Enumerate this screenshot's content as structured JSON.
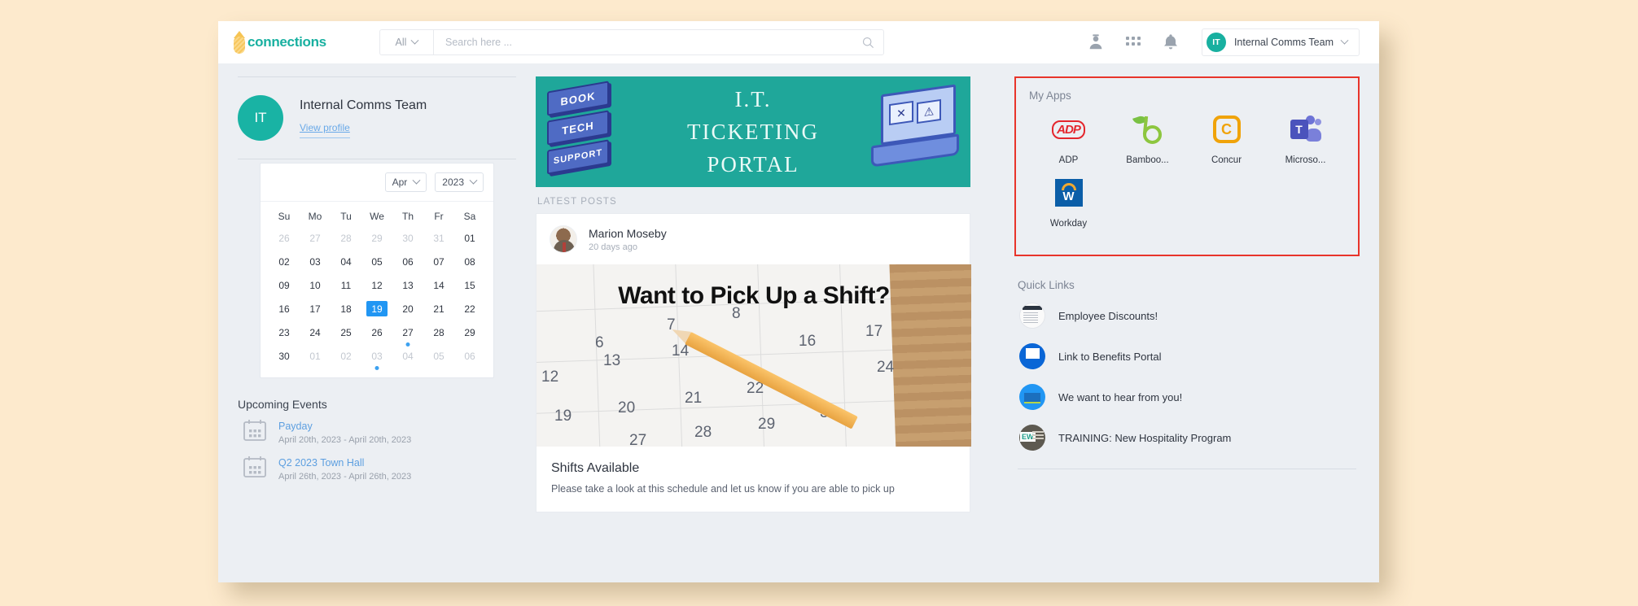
{
  "topbar": {
    "logo_text": "connections",
    "logo_icon": "pineapple-icon",
    "search_scope": "All",
    "search_value": "",
    "search_placeholder": "Search here ...",
    "search_icon": "search-icon",
    "admin_icon": "admin-person-icon",
    "apps_icon": "apps-grid-icon",
    "notifications_icon": "bell-icon",
    "user_initials": "IT",
    "user_name": "Internal Comms Team",
    "user_chevron_icon": "chevron-down-icon"
  },
  "profile": {
    "initials": "IT",
    "name": "Internal Comms Team",
    "view_profile": "View profile"
  },
  "calendar": {
    "month": "Apr",
    "year": "2023",
    "month_chevron_icon": "chevron-down-icon",
    "year_chevron_icon": "chevron-down-icon",
    "dow": [
      "Su",
      "Mo",
      "Tu",
      "We",
      "Th",
      "Fr",
      "Sa"
    ],
    "weeks": [
      [
        {
          "d": "26",
          "mute": true
        },
        {
          "d": "27",
          "mute": true
        },
        {
          "d": "28",
          "mute": true
        },
        {
          "d": "29",
          "mute": true
        },
        {
          "d": "30",
          "mute": true
        },
        {
          "d": "31",
          "mute": true
        },
        {
          "d": "01",
          "mute": false
        }
      ],
      [
        {
          "d": "02"
        },
        {
          "d": "03"
        },
        {
          "d": "04"
        },
        {
          "d": "05"
        },
        {
          "d": "06"
        },
        {
          "d": "07"
        },
        {
          "d": "08"
        }
      ],
      [
        {
          "d": "09"
        },
        {
          "d": "10"
        },
        {
          "d": "11"
        },
        {
          "d": "12"
        },
        {
          "d": "13"
        },
        {
          "d": "14"
        },
        {
          "d": "15"
        }
      ],
      [
        {
          "d": "16"
        },
        {
          "d": "17"
        },
        {
          "d": "18"
        },
        {
          "d": "19",
          "selected": true
        },
        {
          "d": "20"
        },
        {
          "d": "21"
        },
        {
          "d": "22"
        }
      ],
      [
        {
          "d": "23"
        },
        {
          "d": "24"
        },
        {
          "d": "25"
        },
        {
          "d": "26"
        },
        {
          "d": "27",
          "dot": true
        },
        {
          "d": "28"
        },
        {
          "d": "29"
        }
      ],
      [
        {
          "d": "30"
        },
        {
          "d": "01",
          "mute": true
        },
        {
          "d": "02",
          "mute": true
        },
        {
          "d": "03",
          "mute": true,
          "dot": true
        },
        {
          "d": "04",
          "mute": true
        },
        {
          "d": "05",
          "mute": true
        },
        {
          "d": "06",
          "mute": true
        }
      ]
    ],
    "selected_date": "19"
  },
  "upcoming_events": {
    "title": "Upcoming Events",
    "items": [
      {
        "name": "Payday",
        "date": "April 20th, 2023 - April 20th, 2023",
        "icon": "calendar-icon"
      },
      {
        "name": "Q2 2023 Town Hall",
        "date": "April 26th, 2023 - April 26th, 2023",
        "icon": "calendar-icon"
      }
    ]
  },
  "banner": {
    "line1": "I.T.",
    "line2": "TICKETING",
    "line3": "PORTAL",
    "block1": "BOOK",
    "block2": "TECH",
    "block3": "SUPPORT",
    "bg_color": "#1fa79a"
  },
  "feed": {
    "section_label": "LATEST POSTS",
    "post": {
      "author": "Marion Moseby",
      "time": "20 days ago",
      "image_text": "Want to Pick Up a Shift?",
      "title": "Shifts Available",
      "body": "Please take a look at this schedule and let us know if you are able to pick up"
    }
  },
  "my_apps": {
    "title": "My Apps",
    "border_color": "#e8342a",
    "apps": [
      {
        "label": "ADP",
        "icon": "adp-icon"
      },
      {
        "label": "Bamboo...",
        "icon": "bamboohr-icon"
      },
      {
        "label": "Concur",
        "icon": "concur-icon"
      },
      {
        "label": "Microso...",
        "icon": "microsoft-teams-icon"
      },
      {
        "label": "Workday",
        "icon": "workday-icon"
      }
    ]
  },
  "quick_links": {
    "title": "Quick Links",
    "items": [
      {
        "label": "Employee Discounts!",
        "icon": "newspaper-thumbnail-icon"
      },
      {
        "label": "Link to Benefits Portal",
        "icon": "document-thumbnail-icon"
      },
      {
        "label": "We want to hear from you!",
        "icon": "survey-thumbnail-icon"
      },
      {
        "label": "TRAINING: New Hospitality Program",
        "icon": "training-thumbnail-icon"
      }
    ]
  }
}
